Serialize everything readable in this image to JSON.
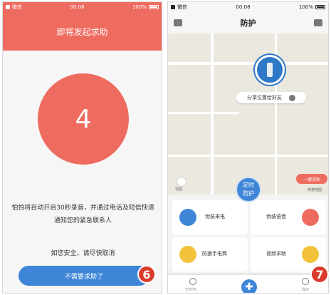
{
  "left_screen": {
    "status": {
      "carrier": "微信",
      "time": "00:08",
      "battery": "100%"
    },
    "title": "即将发起求助",
    "countdown": "4",
    "description": "怕怕将自动开启30秒录音，并通过电话及短信快速通知您的紧急联系人",
    "reminder": "如您安全，请尽快取消",
    "cancel_button": "不需要求助了",
    "step_badge": "6"
  },
  "right_screen": {
    "status": {
      "carrier": "微信",
      "time": "00:08",
      "battery": "100%"
    },
    "title": "防护",
    "share_location": "分享位置给好友",
    "help_button": "一键求助",
    "map_credit": "高德地图",
    "map_credit_left": "怕怕",
    "timer_button": "定时防护",
    "cards": [
      {
        "label": "伪装来电",
        "icon": "phone-call-icon",
        "color": "#3f86d8"
      },
      {
        "label": "伪装语音",
        "icon": "microphone-icon",
        "color": "#ee6b5f"
      },
      {
        "label": "防狼手电筒",
        "icon": "flashlight-icon",
        "color": "#f2c23b"
      },
      {
        "label": "视频求助",
        "icon": "video-icon",
        "color": "#f2c23b"
      }
    ],
    "tabs": [
      {
        "label": "守护TA"
      },
      {
        "label": ""
      },
      {
        "label": "我的"
      }
    ],
    "step_badge": "7"
  }
}
